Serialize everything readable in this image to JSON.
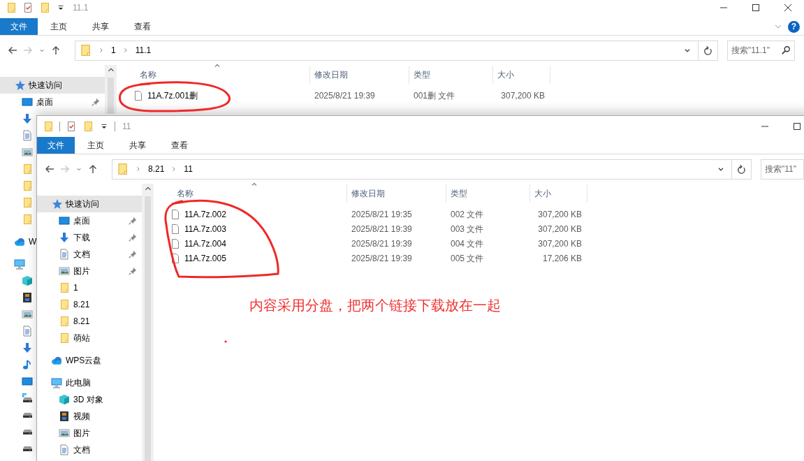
{
  "windows": [
    {
      "title": "11.1",
      "ribbon_tabs": [
        {
          "label": "文件",
          "selected": true
        },
        {
          "label": "主页",
          "selected": false
        },
        {
          "label": "共享",
          "selected": false
        },
        {
          "label": "查看",
          "selected": false
        }
      ],
      "window_buttons": [
        {
          "kind": "minimize"
        },
        {
          "kind": "maximize"
        },
        {
          "kind": "close"
        }
      ],
      "help_button": "?",
      "nav": [
        {
          "kind": "back",
          "disabled": false
        },
        {
          "kind": "forward",
          "disabled": true
        },
        {
          "kind": "recent",
          "disabled": false
        },
        {
          "kind": "up",
          "disabled": false
        }
      ],
      "path": [
        "1",
        "11.1"
      ],
      "search": {
        "placeholder": "搜索\"11.1\""
      },
      "sidebar": [
        {
          "kind": "star",
          "label": "快速访问",
          "selected": true,
          "children": [
            {
              "kind": "desktop",
              "label": "桌面",
              "pinned": true
            },
            {
              "kind": "download",
              "pinned": false
            },
            {
              "kind": "document",
              "pinned": false
            },
            {
              "kind": "picture",
              "pinned": false
            },
            {
              "kind": "folder",
              "pinned": false
            },
            {
              "kind": "folder",
              "pinned": false
            },
            {
              "kind": "folder",
              "pinned": false
            },
            {
              "kind": "folder",
              "pinned": false
            }
          ]
        },
        {
          "kind": "cloud",
          "label": "W",
          "selected": false
        },
        {
          "kind": "pc",
          "selected": false,
          "children": [
            {
              "kind": "cube",
              "pinned": false
            },
            {
              "kind": "video",
              "pinned": false
            },
            {
              "kind": "picture",
              "pinned": false
            },
            {
              "kind": "document",
              "pinned": false
            },
            {
              "kind": "download",
              "pinned": false
            },
            {
              "kind": "music",
              "pinned": false
            },
            {
              "kind": "desktop",
              "pinned": false
            },
            {
              "kind": "windrive",
              "pinned": false
            },
            {
              "kind": "drive",
              "pinned": false
            },
            {
              "kind": "drive",
              "pinned": false
            },
            {
              "kind": "drive",
              "pinned": false
            }
          ]
        }
      ],
      "columns": [
        {
          "label": "名称",
          "sorted": true
        },
        {
          "label": "修改日期",
          "sorted": false
        },
        {
          "label": "类型",
          "sorted": false
        },
        {
          "label": "大小",
          "sorted": false
        }
      ],
      "files": [
        {
          "name": "11A.7z.001删",
          "modified": "2025/8/21 19:39",
          "type": "001删 文件",
          "size": "307,200 KB"
        }
      ]
    },
    {
      "title": "11",
      "ribbon_tabs": [
        {
          "label": "文件",
          "selected": true
        },
        {
          "label": "主页",
          "selected": false
        },
        {
          "label": "共享",
          "selected": false
        },
        {
          "label": "查看",
          "selected": false
        }
      ],
      "window_buttons": [
        {
          "kind": "minimize"
        },
        {
          "kind": "maximize"
        }
      ],
      "nav": [
        {
          "kind": "back",
          "disabled": false
        },
        {
          "kind": "forward",
          "disabled": true
        },
        {
          "kind": "recent",
          "disabled": false
        },
        {
          "kind": "up",
          "disabled": false
        }
      ],
      "path": [
        "8.21",
        "11"
      ],
      "search": {
        "placeholder": "搜索\"11\""
      },
      "sidebar": [
        {
          "kind": "star",
          "label": "快速访问",
          "selected": true,
          "children": [
            {
              "kind": "desktop",
              "label": "桌面",
              "pinned": true
            },
            {
              "kind": "download",
              "label": "下载",
              "pinned": true
            },
            {
              "kind": "document",
              "label": "文档",
              "pinned": true
            },
            {
              "kind": "picture",
              "label": "图片",
              "pinned": true
            },
            {
              "kind": "folder",
              "label": "1",
              "pinned": false
            },
            {
              "kind": "folder",
              "label": "8.21",
              "pinned": false
            },
            {
              "kind": "folder",
              "label": "8.21",
              "pinned": false
            },
            {
              "kind": "folder",
              "label": "萌站",
              "pinned": false
            }
          ]
        },
        {
          "kind": "cloud",
          "label": "WPS云盘",
          "selected": false
        },
        {
          "kind": "pc",
          "label": "此电脑",
          "selected": false,
          "children": [
            {
              "kind": "cube",
              "label": "3D 对象",
              "pinned": false
            },
            {
              "kind": "video",
              "label": "视频",
              "pinned": false
            },
            {
              "kind": "picture",
              "label": "图片",
              "pinned": false
            },
            {
              "kind": "document",
              "label": "文档",
              "pinned": false
            }
          ]
        }
      ],
      "columns": [
        {
          "label": "名称",
          "sorted": true
        },
        {
          "label": "修改日期",
          "sorted": false
        },
        {
          "label": "类型",
          "sorted": false
        },
        {
          "label": "大小",
          "sorted": false
        }
      ],
      "files": [
        {
          "name": "11A.7z.002",
          "modified": "2025/8/21 19:35",
          "type": "002 文件",
          "size": "307,200 KB"
        },
        {
          "name": "11A.7z.003",
          "modified": "2025/8/21 19:39",
          "type": "003 文件",
          "size": "307,200 KB"
        },
        {
          "name": "11A.7z.004",
          "modified": "2025/8/21 19:39",
          "type": "004 文件",
          "size": "307,200 KB"
        },
        {
          "name": "11A.7z.005",
          "modified": "2025/8/21 19:39",
          "type": "005 文件",
          "size": "17,206 KB"
        }
      ]
    }
  ],
  "annotation": {
    "text": "内容采用分盘，把两个链接下载放在一起"
  }
}
